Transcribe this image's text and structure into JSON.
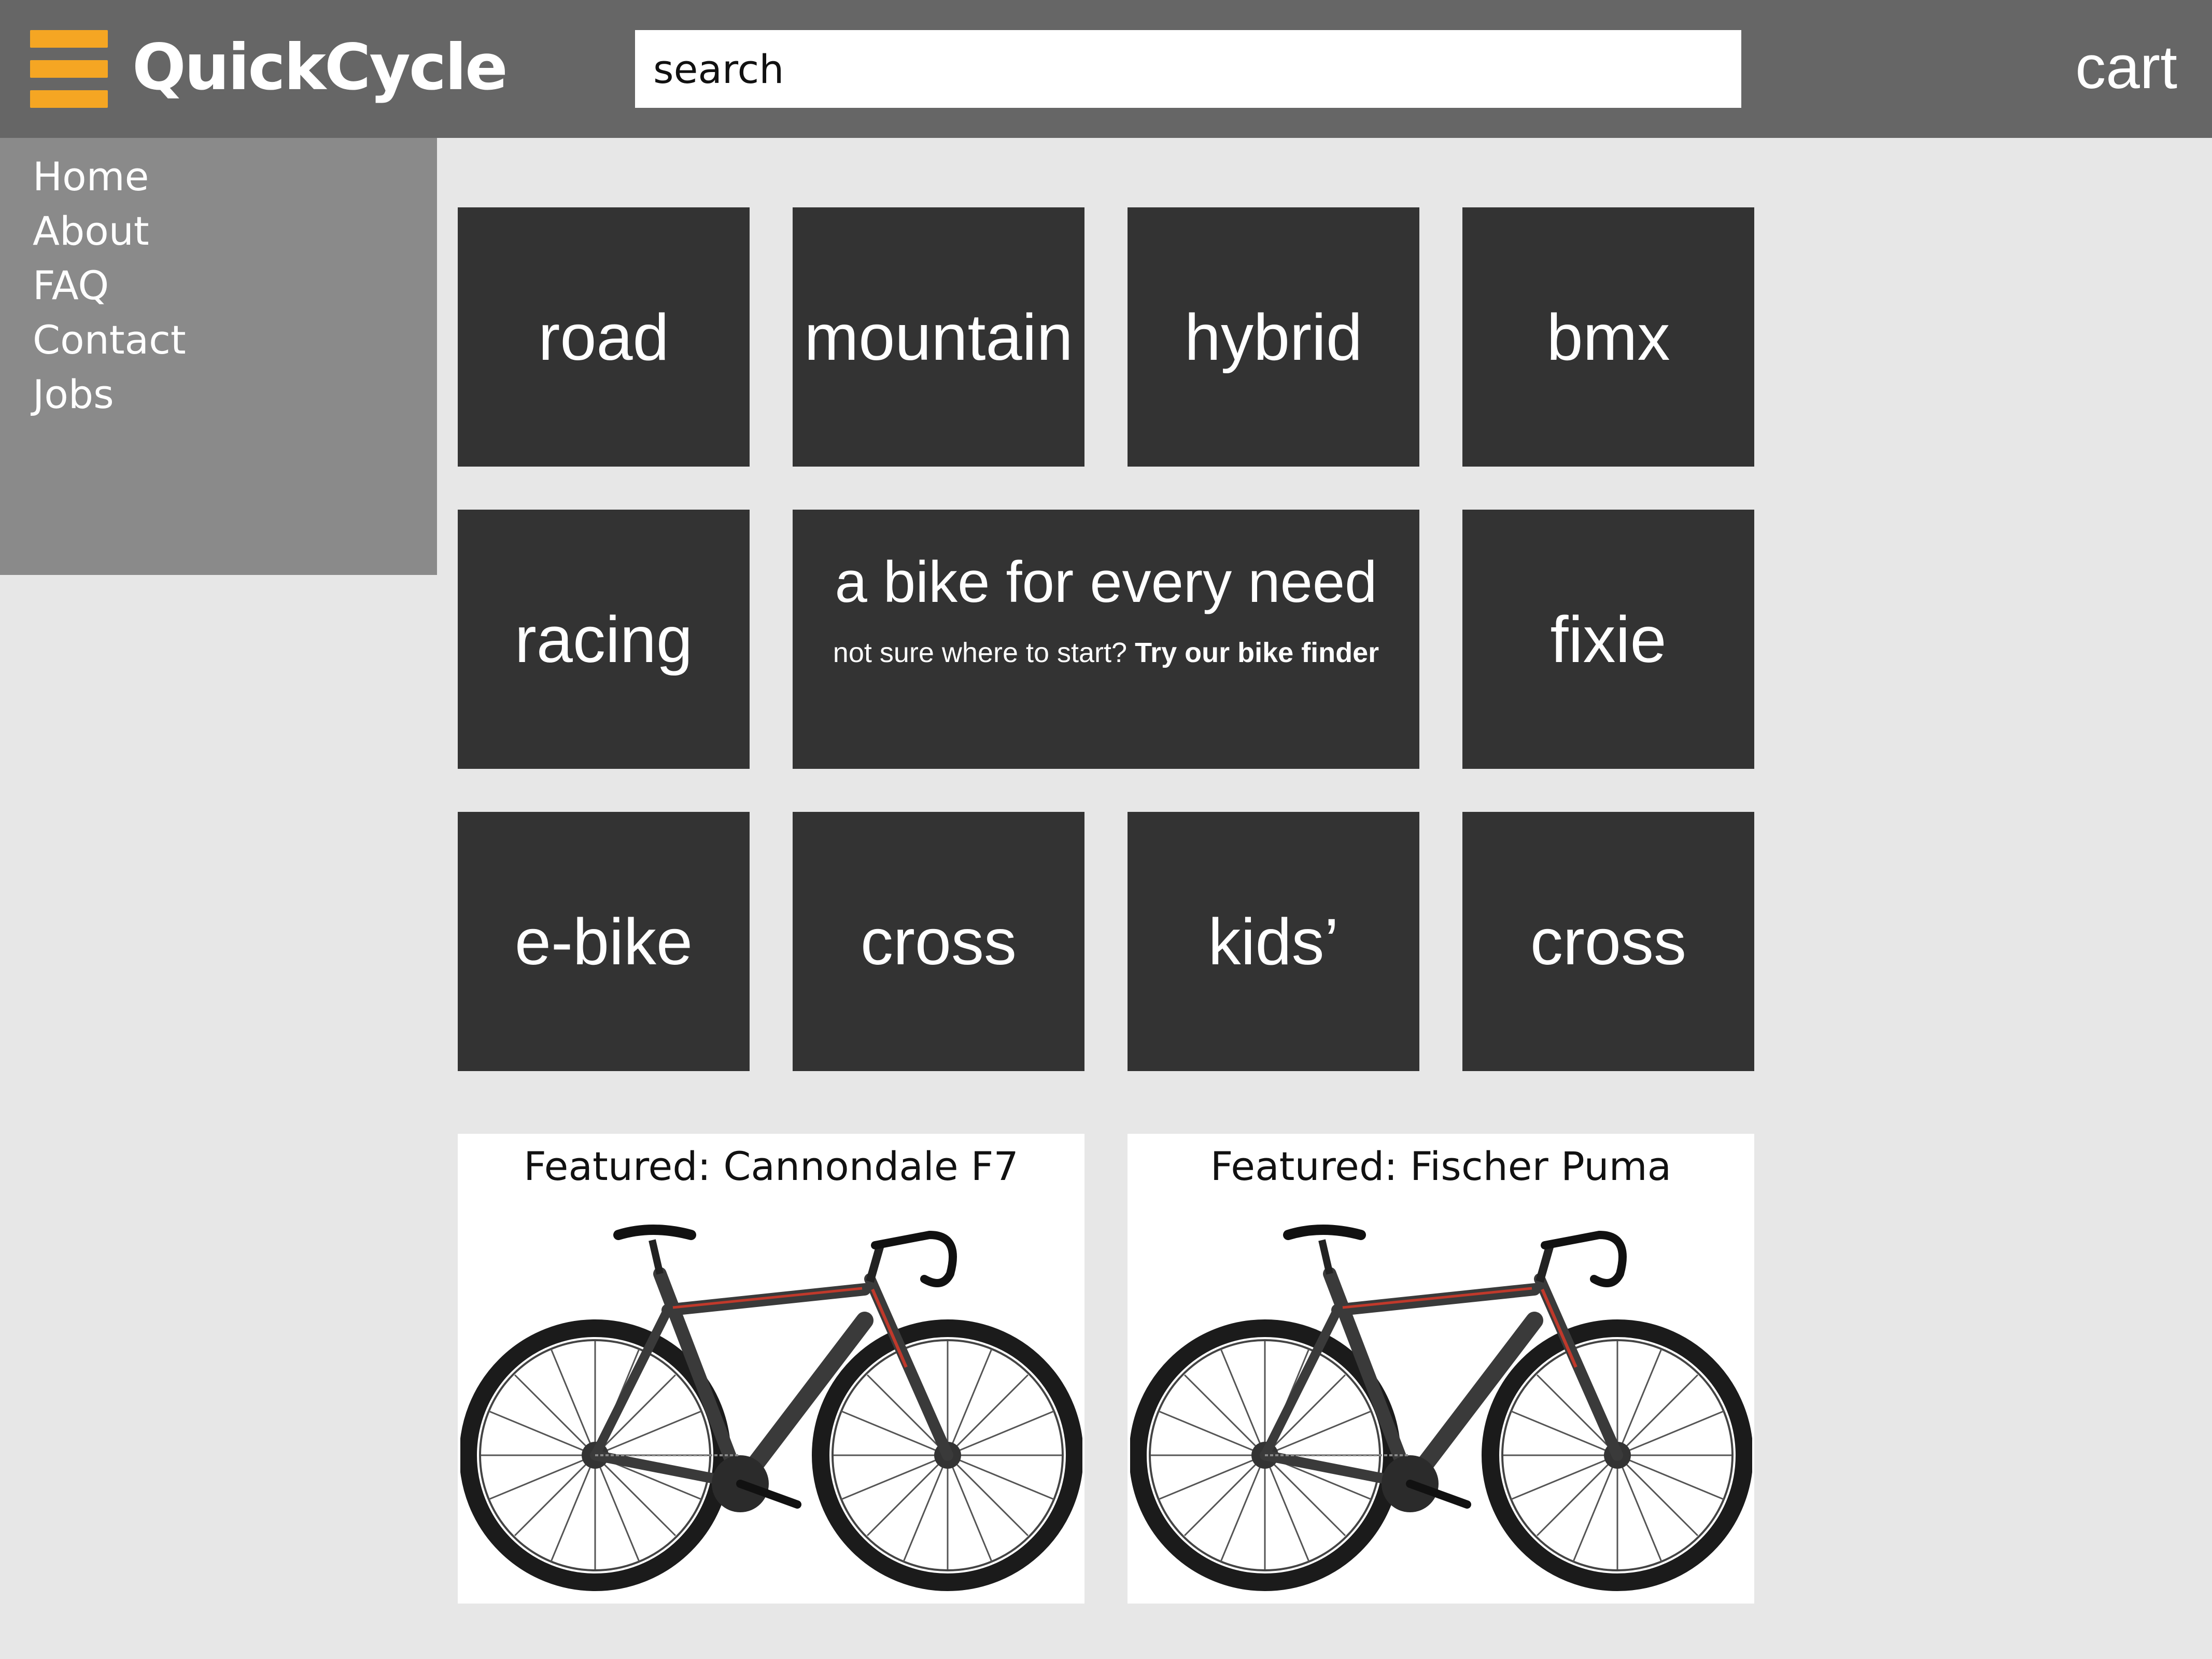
{
  "header": {
    "logo": "QuickCycle",
    "search_placeholder": "search",
    "cart_label": "cart",
    "accent_color": "#f5a623",
    "bar_color": "#666666"
  },
  "sidebar": {
    "items": [
      {
        "label": "Home"
      },
      {
        "label": "About"
      },
      {
        "label": "FAQ"
      },
      {
        "label": "Contact"
      },
      {
        "label": "Jobs"
      }
    ]
  },
  "categories": {
    "road": "road",
    "mountain": "mountain",
    "hybrid": "hybrid",
    "bmx": "bmx",
    "racing": "racing",
    "fixie": "fixie",
    "ebike": "e-bike",
    "cross_1": "cross",
    "kids": "kids’",
    "cross_2": "cross"
  },
  "promo": {
    "title": "a bike for every need",
    "subtitle_prefix": "not sure where to start?",
    "link_text": "Try our bike finder"
  },
  "featured": [
    {
      "title": "Featured: Cannondale F7"
    },
    {
      "title": "Featured: Fischer Puma"
    }
  ]
}
